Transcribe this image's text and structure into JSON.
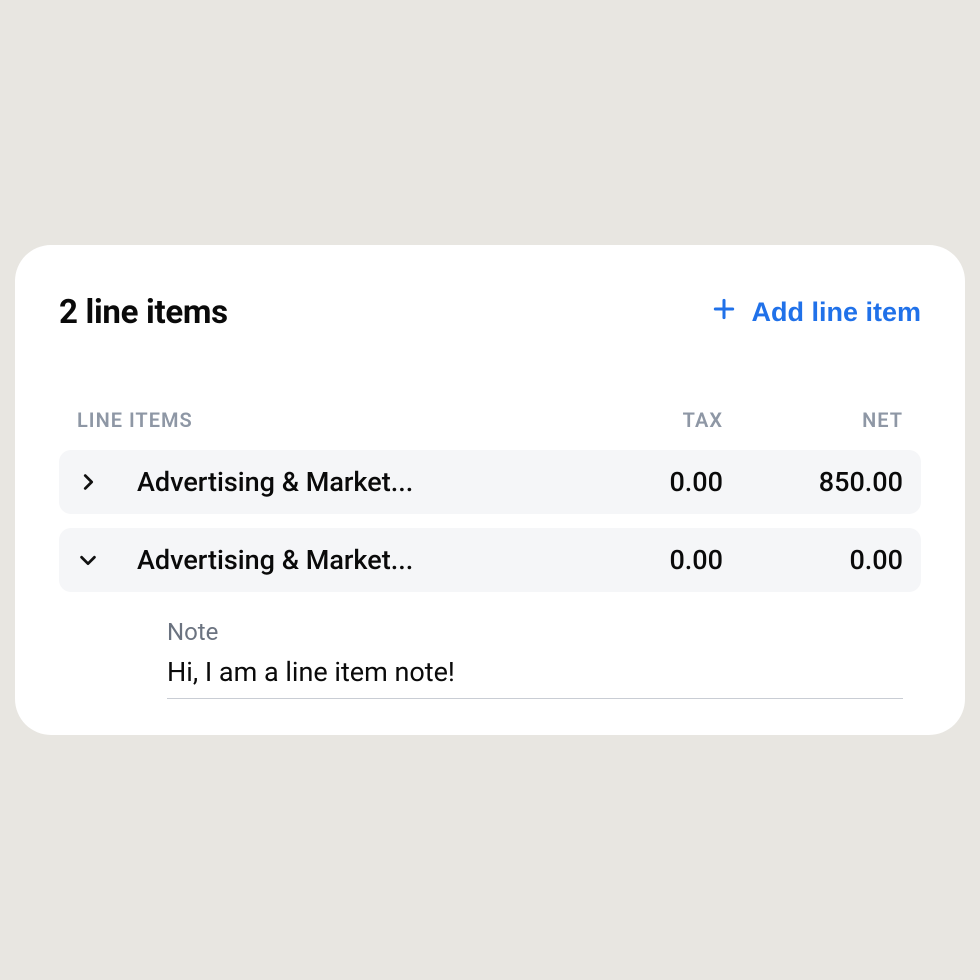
{
  "header": {
    "title": "2 line items",
    "add_label": "Add line item"
  },
  "columns": {
    "items": "LINE ITEMS",
    "tax": "TAX",
    "net": "NET"
  },
  "rows": [
    {
      "name": "Advertising & Market...",
      "tax": "0.00",
      "net": "850.00",
      "expanded": false
    },
    {
      "name": "Advertising & Market...",
      "tax": "0.00",
      "net": "0.00",
      "expanded": true
    }
  ],
  "note": {
    "label": "Note",
    "value": "Hi, I am a line item note!"
  }
}
